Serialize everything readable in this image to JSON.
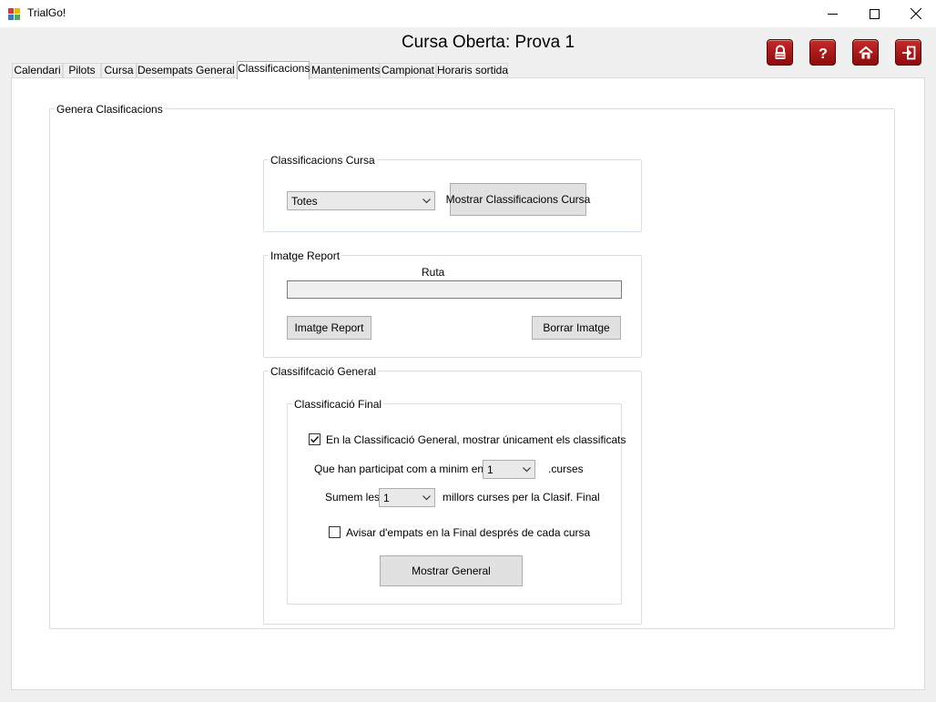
{
  "window": {
    "title": "TrialGo!"
  },
  "header": {
    "title": "Cursa Oberta: Prova 1"
  },
  "toolbar": [
    {
      "icon": "lock-icon"
    },
    {
      "icon": "help-icon"
    },
    {
      "icon": "home-icon"
    },
    {
      "icon": "exit-icon"
    }
  ],
  "tabs": [
    {
      "label": "Calendari"
    },
    {
      "label": "Pilots"
    },
    {
      "label": "Cursa"
    },
    {
      "label": "Desempats General"
    },
    {
      "label": "Classificacions",
      "active": true
    },
    {
      "label": "Manteniments"
    },
    {
      "label": "Campionat"
    },
    {
      "label": "Horaris sortida"
    }
  ],
  "main": {
    "group_label": "Genera Clasificacions",
    "race_group": {
      "label": "Classificacions Cursa",
      "combo_value": "Totes",
      "show_button": "Mostrar Classificacions Cursa"
    },
    "image_group": {
      "label": "Imatge Report",
      "path_label": "Ruta",
      "path_value": "",
      "image_button": "Imatge Report",
      "delete_button": "Borrar Imatge"
    },
    "general_group": {
      "label": "Classififcació General",
      "final_group": {
        "label": "Classificació Final",
        "only_classified_label": "En la Classificació General, mostrar únicament els classificats",
        "only_classified_checked": true,
        "min_label": "Que han participat com a minim en",
        "min_value": "1",
        "min_suffix": ".curses",
        "sum_label": "Sumem les",
        "sum_value": "1",
        "sum_suffix": "millors curses per la Clasif. Final",
        "warn_label": "Avisar d'empats en la Final després de cada cursa",
        "warn_checked": false,
        "show_general_button": "Mostrar General"
      }
    }
  }
}
